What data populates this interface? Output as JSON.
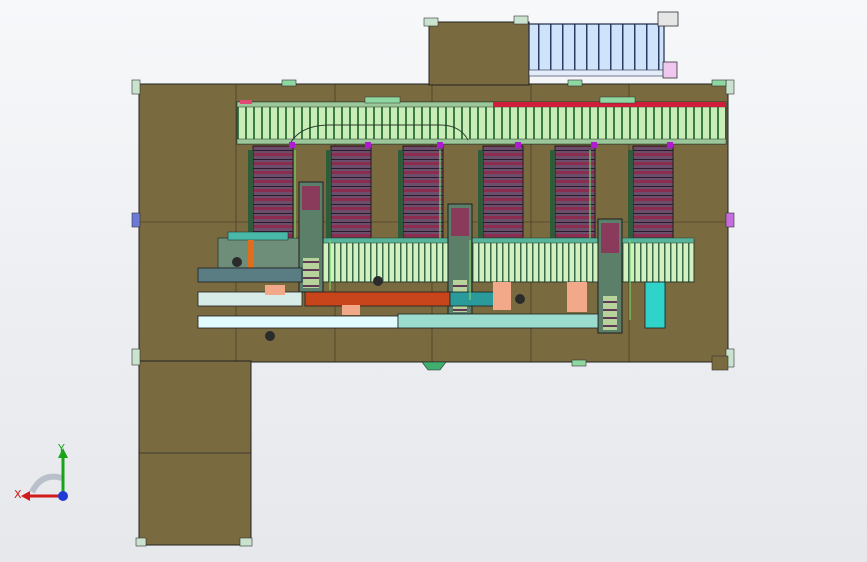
{
  "view": {
    "document_type": "assembly drawing (CAD top view)",
    "background": [
      "#f7f8fa",
      "#e6e8ec"
    ]
  },
  "triad": {
    "x_label": "X",
    "y_label": "Y",
    "x_color": "#d21a1a",
    "y_color": "#19a319",
    "z_color": "#1f3bd6",
    "icon": "coordinate-triad-icon"
  },
  "colors": {
    "floor": "#7a6a3f",
    "floor_edge": "#2b2b2b",
    "conveyor_roller": "#b7e0a3",
    "conveyor_frame": "#3b6a4a",
    "rack": "#8c2c4f",
    "accent_red": "#d01d3a",
    "accent_magenta": "#b01ad0",
    "cyan_part": "#2fd3c9",
    "glass_panel": "#b7d6f5"
  }
}
